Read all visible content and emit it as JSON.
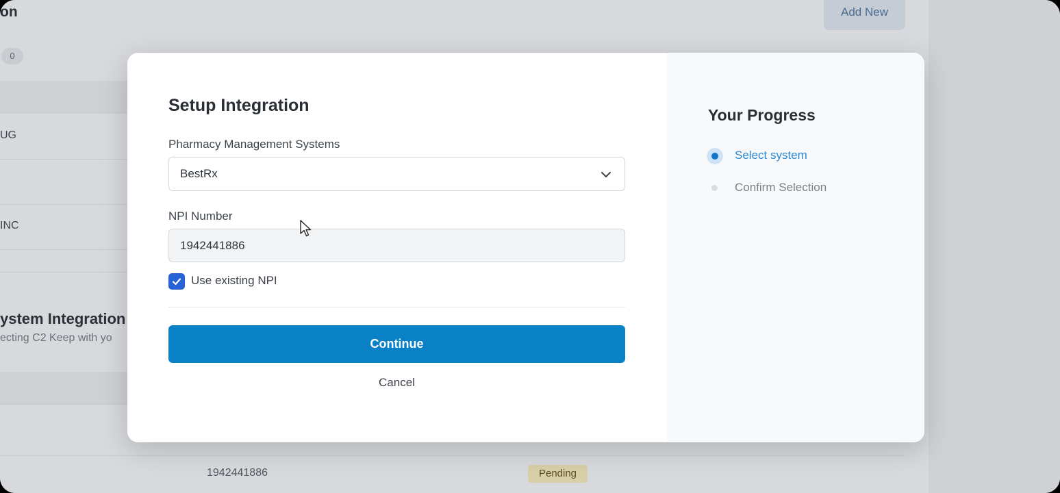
{
  "background": {
    "title": "on",
    "badge_count": "0",
    "add_new_label": "Add New",
    "rows": [
      "UG",
      "INC"
    ],
    "section_title": "ystem Integration",
    "section_subtitle": "ecting C2 Keep with yo",
    "table_npi": "1942441886",
    "table_status": "Pending"
  },
  "modal": {
    "title": "Setup Integration",
    "pms_label": "Pharmacy Management Systems",
    "pms_selected": "BestRx",
    "npi_label": "NPI Number",
    "npi_value": "1942441886",
    "use_existing_npi_label": "Use existing NPI",
    "use_existing_npi_checked": true,
    "continue_label": "Continue",
    "cancel_label": "Cancel"
  },
  "progress": {
    "title": "Your Progress",
    "steps": [
      {
        "label": "Select system",
        "state": "active"
      },
      {
        "label": "Confirm Selection",
        "state": "inactive"
      }
    ]
  },
  "colors": {
    "primary": "#0a80c7",
    "checkbox": "#2563d6",
    "active_step": "#2d86d0"
  }
}
